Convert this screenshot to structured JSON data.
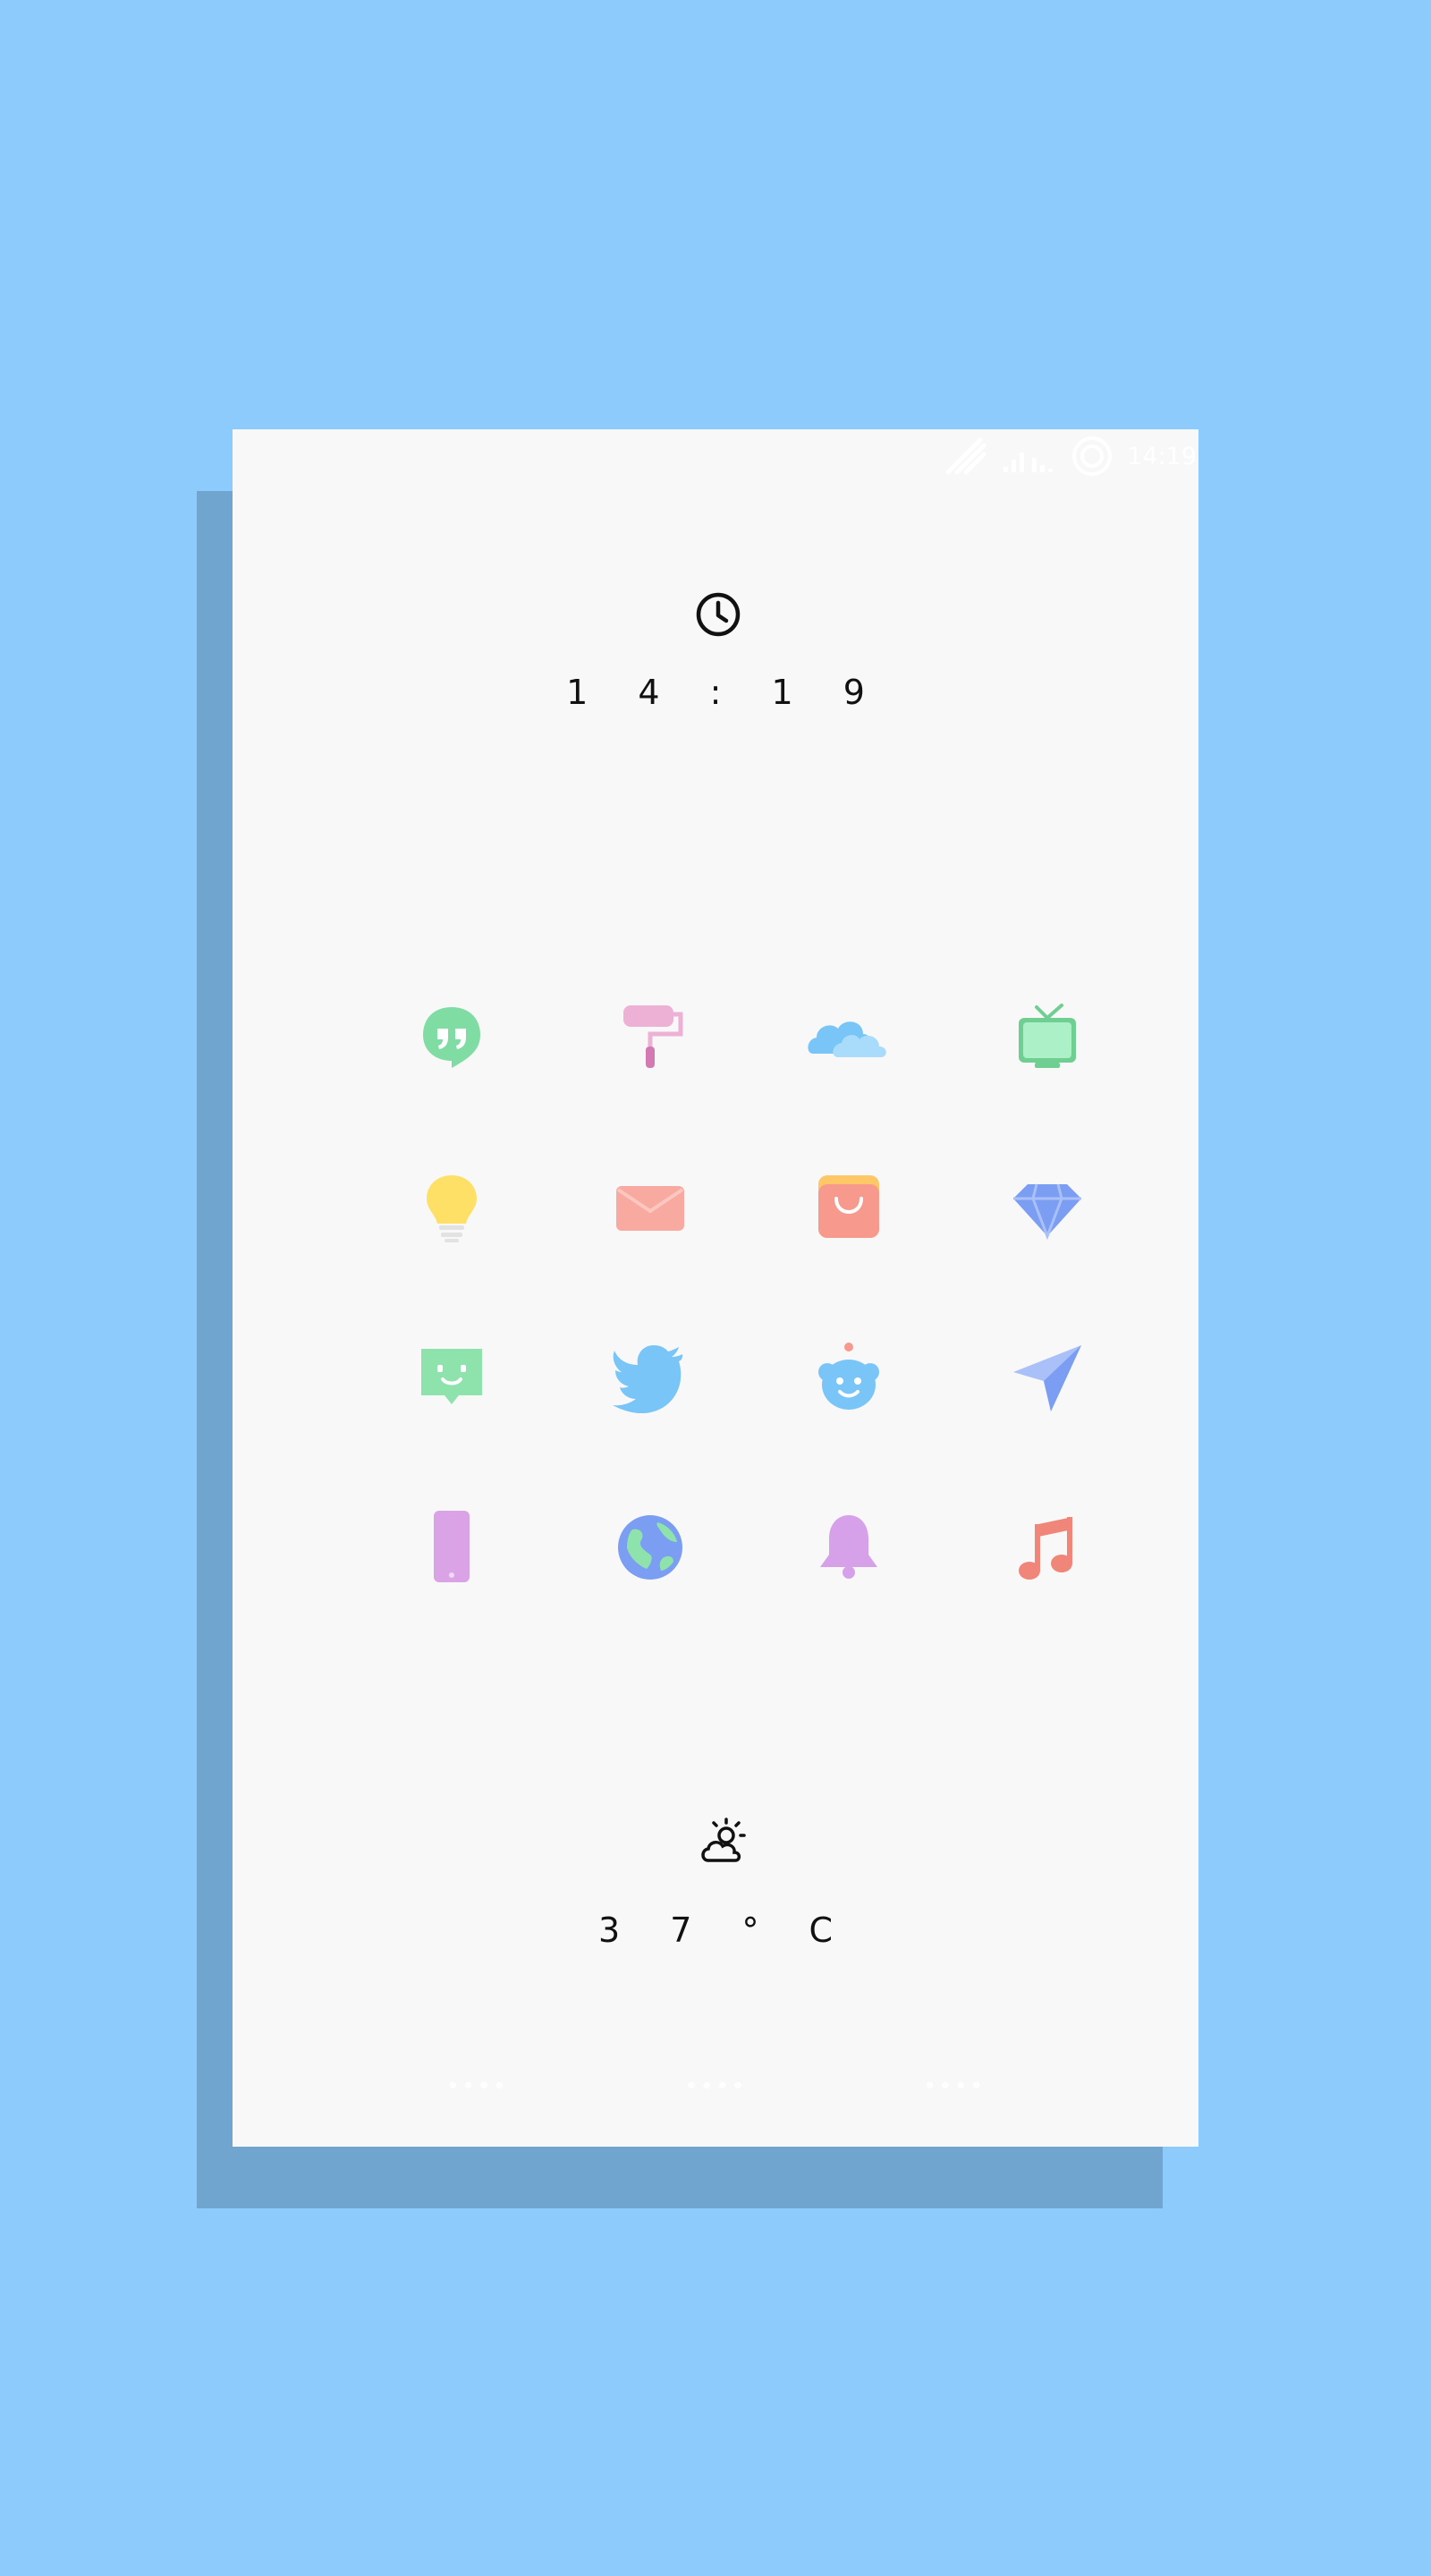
{
  "status_bar": {
    "time": "14:19",
    "icons": [
      "nfc-icon",
      "signal-icon",
      "battery-ring-icon"
    ]
  },
  "clock": {
    "icon": "clock-icon",
    "time": "1 4 : 1 9"
  },
  "apps": [
    {
      "name": "hangouts-app-icon",
      "color": "#7fdca2"
    },
    {
      "name": "paint-roller-app-icon",
      "color": "#eeb1d6"
    },
    {
      "name": "cloud-app-icon",
      "color": "#79c5f7"
    },
    {
      "name": "tv-app-icon",
      "color": "#8ee3ad"
    },
    {
      "name": "lightbulb-app-icon",
      "color": "#ffe066"
    },
    {
      "name": "mail-app-icon",
      "color": "#f8a9a0"
    },
    {
      "name": "shopping-bag-app-icon",
      "color": "#f79a8d"
    },
    {
      "name": "diamond-app-icon",
      "color": "#7b9ef2"
    },
    {
      "name": "chat-bot-app-icon",
      "color": "#8ee3ad"
    },
    {
      "name": "twitter-app-icon",
      "color": "#79c5f7"
    },
    {
      "name": "reddit-app-icon",
      "color": "#79c5f7"
    },
    {
      "name": "paper-plane-app-icon",
      "color": "#8fb0f0"
    },
    {
      "name": "phone-app-icon",
      "color": "#d9a3e6"
    },
    {
      "name": "globe-app-icon",
      "color": "#7b9ef2"
    },
    {
      "name": "bell-app-icon",
      "color": "#d6a1e8"
    },
    {
      "name": "music-note-app-icon",
      "color": "#f0867a"
    }
  ],
  "weather": {
    "icon": "partly-cloudy-icon",
    "temp": "3 7 ° C"
  },
  "page_dots": [
    "••••",
    "••••",
    "••••"
  ]
}
